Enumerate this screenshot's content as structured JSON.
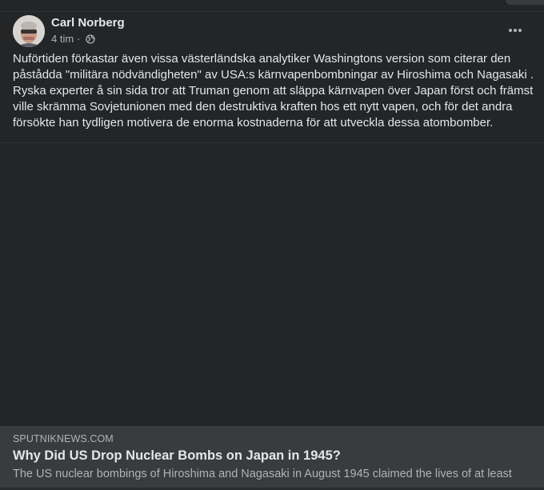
{
  "post": {
    "author": "Carl Norberg",
    "time": "4 tim",
    "separator": "·",
    "privacy_icon": "globe-icon",
    "more_icon": "more-options-icon",
    "text": "Nuförtiden förkastar även vissa västerländska analytiker Washingtons version som citerar den påstådda \"militära nödvändigheten\" av USA:s kärnvapenbombningar av Hiroshima och Nagasaki . Ryska experter å sin sida tror att Truman genom att släppa kärnvapen över Japan först och främst ville skrämma Sovjetunionen med den destruktiva kraften hos ett nytt vapen, och för det andra försökte han tydligen motivera de enorma kostnaderna för att utveckla dessa atombomber."
  },
  "link_preview": {
    "domain": "SPUTNIKNEWS.COM",
    "title": "Why Did US Drop Nuclear Bombs on Japan in 1945?",
    "description": "The US nuclear bombings of Hiroshima and Nagasaki in August 1945 claimed the lives of at least"
  },
  "colors": {
    "background": "#242526",
    "card_background": "#3a3b3c",
    "primary_text": "#e4e6eb",
    "secondary_text": "#b0b3b8"
  }
}
